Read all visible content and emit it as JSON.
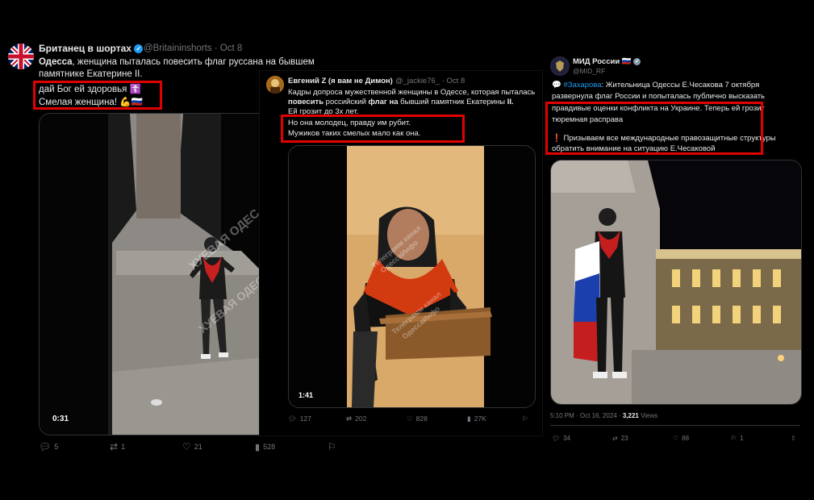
{
  "tweet1": {
    "name": "Британец в шортах",
    "handle": "@Britaininshorts",
    "date": "Oct 8",
    "line1_bold": "Одесса",
    "line1_rest": ", женщина пыталась повесить флаг руссана на бывшем",
    "line2": "памятнике Екатерине II.",
    "line3": "дай Бог ей здоровья ☦️",
    "line4": "Смелая женщина! 💪🇷🇺",
    "duration": "0:31",
    "watermark1": "ХУЕВАЯ ОДЕС",
    "watermark2": "ХУЕВАЯ ОДЕССА",
    "replies": "5",
    "reposts": "1",
    "likes": "21",
    "views": "528"
  },
  "tweet2": {
    "name": "Евгений Z (я вам не Димон)",
    "handle": "@_jackie76_",
    "date": "Oct 8",
    "l1": "Кадры допроса мужественной женщины в Одессе, которая пыталась",
    "l2a": "повесить",
    "l2b": " российский ",
    "l2c": "флаг на",
    "l2d": " бывший памятник Екатерины ",
    "l2e": "II.",
    "l3": "Ей грозит до 3х лет.",
    "l4": "Но она молодец, правду им рубит.",
    "l5": "Мужиков таких смелых мало как она.",
    "duration": "1:41",
    "watermark1": "Телеграмм канал",
    "watermark2": "ОдессаИнфо",
    "replies": "127",
    "reposts": "202",
    "likes": "828",
    "views": "27K"
  },
  "tweet3": {
    "name": "МИД России 🇷🇺",
    "handle": "@MID_RF",
    "hashtag": "#Захарова",
    "l1b": ": Жительница Одессы Е.Чесакова 7 октября",
    "l2": "развернула флаг России и попыталась публично высказать",
    "l3": "правдивые оценки конфликта на Украине. Теперь ей грозит",
    "l4": "тюремная расправа",
    "l5": "❗ Призываем все международные правозащитные структуры",
    "l6": "обратить внимание на ситуацию Е.Чесаковой",
    "meta_time": "5:10 PM · Oct 16, 2024 · ",
    "views_num": "3,221",
    "views_label": " Views",
    "replies": "34",
    "reposts": "23",
    "likes": "88",
    "bookmarks": "1"
  },
  "colors": {
    "highlight": "#e00000",
    "link": "#1d9bf0",
    "muted": "#71767b"
  }
}
